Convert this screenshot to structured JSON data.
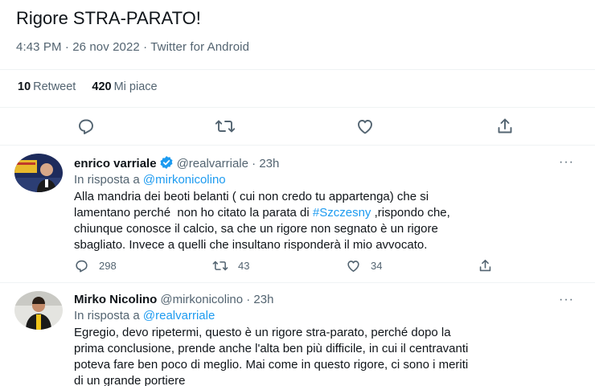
{
  "tweet": {
    "text": "Rigore STRA-PARATO!",
    "meta": "4:43 PM · 26 nov 2022 · Twitter for Android",
    "retweets_count": "10",
    "retweets_label": "Retweet",
    "likes_count": "420",
    "likes_label": "Mi piace"
  },
  "main_actions": [
    "reply-icon",
    "retweet-icon",
    "like-icon",
    "share-icon"
  ],
  "replies": [
    {
      "name": "enrico varriale",
      "handle": "@realvarriale · 23h",
      "verified": true,
      "replying_prefix": "In risposta a ",
      "replying_to": "@mirkonicolino",
      "body_before_hashtag": "Alla mandria dei beoti belanti ( cui non credo tu appartenga) che si\nlamentano perché  non ho citato la parata di ",
      "hashtag": "#Szczesny",
      "body_after_hashtag": " ,rispondo che,\nchiunque conosce il calcio, sa che un rigore non segnato è un rigore\nsbagliato. Invece a quelli che insultano risponderà il mio avvocato.",
      "reply_count": "298",
      "retweet_count": "43",
      "like_count": "34",
      "more": "···"
    },
    {
      "name": "Mirko Nicolino",
      "handle": "@mirkonicolino · 23h",
      "verified": false,
      "replying_prefix": "In risposta a ",
      "replying_to": "@realvarriale",
      "body": "Egregio, devo ripetermi, questo è un rigore stra-parato, perché dopo la\nprima conclusione, prende anche l'alta ben più difficile, in cui il centravanti\npoteva fare ben poco di meglio. Mai come in questo rigore, ci sono i meriti\ndi un grande portiere",
      "more": "···"
    }
  ],
  "colors": {
    "text": "#0f1419",
    "secondary": "#536471",
    "accent": "#1d9bf0",
    "divider": "#eff3f4"
  }
}
